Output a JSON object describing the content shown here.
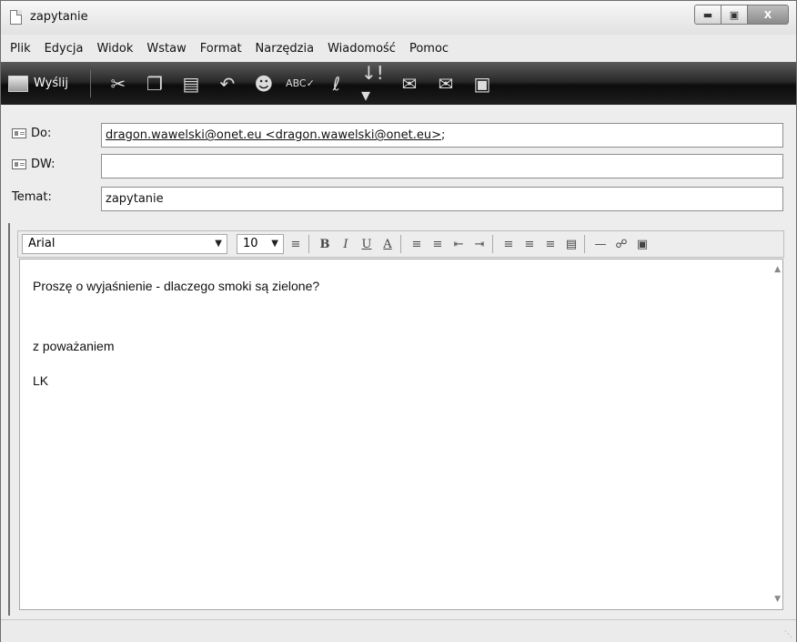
{
  "window": {
    "title": "zapytanie",
    "minimize": "▭",
    "maximize": "▣",
    "close": "X"
  },
  "menu": [
    {
      "label": "Plik"
    },
    {
      "label": "Edycja"
    },
    {
      "label": "Widok"
    },
    {
      "label": "Wstaw"
    },
    {
      "label": "Format"
    },
    {
      "label": "Narzędzia"
    },
    {
      "label": "Wiadomość"
    },
    {
      "label": "Pomoc"
    }
  ],
  "toolbar": {
    "send_label": "Wyślij",
    "icons": [
      "scissors-icon",
      "copy-icon",
      "paste-icon",
      "undo-icon",
      "check-names-icon",
      "spelling-icon",
      "attach-icon",
      "priority-icon",
      "sign-icon",
      "encrypt-icon",
      "offline-icon"
    ]
  },
  "fields": {
    "to_label": "Do:",
    "to_value": "dragon.wawelski@onet.eu <dragon.wawelski@onet.eu>",
    "to_suffix": ";",
    "cc_label": "DW:",
    "cc_value": "",
    "subject_label": "Temat:",
    "subject_value": "zapytanie"
  },
  "format": {
    "font": "Arial",
    "size": "10"
  },
  "body": {
    "line1": "Proszę o wyjaśnienie - dlaczego smoki są zielone?",
    "line2": "z poważaniem",
    "line3": "LK"
  }
}
